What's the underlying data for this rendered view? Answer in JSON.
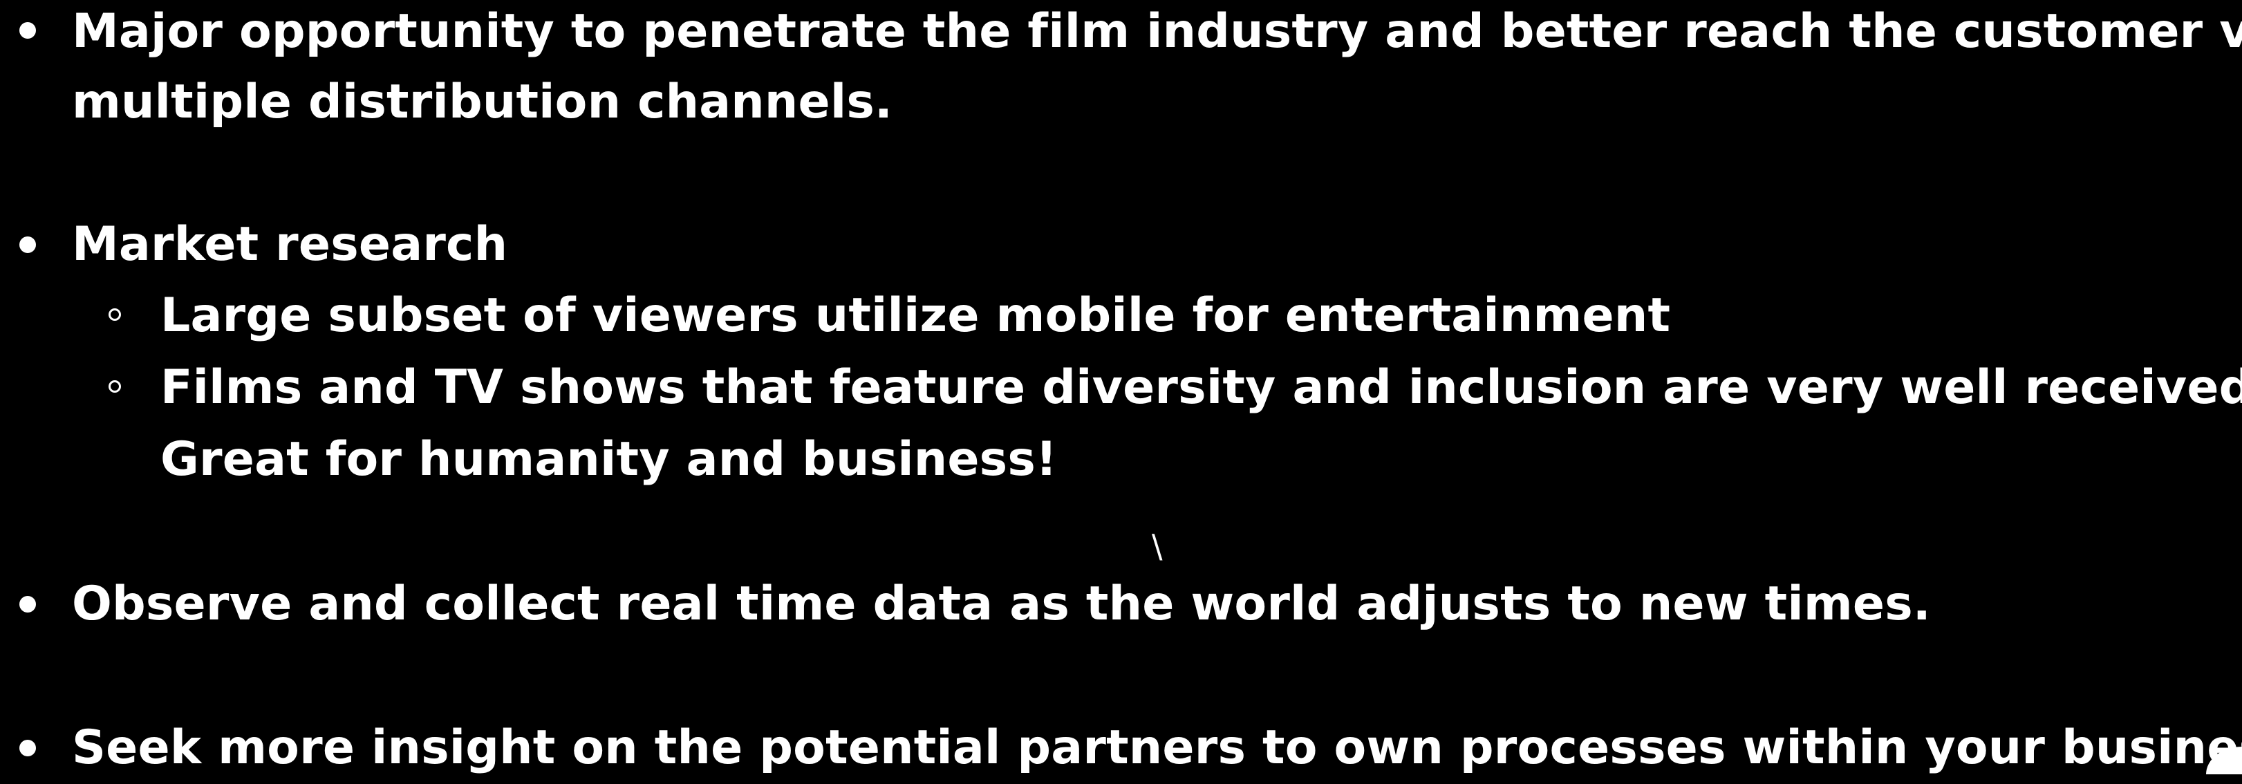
{
  "bullets": {
    "b1_line1": "Major opportunity to penetrate the film industry and better reach the customer via",
    "b1_line2": "multiple distribution channels.",
    "b2": "Market research",
    "b2_sub1": "Large subset of  viewers utilize mobile for entertainment",
    "b2_sub2_line1": "Films and TV shows that feature diversity and inclusion are very well received.",
    "b2_sub2_line2": "Great for humanity and business!",
    "b3": "Observe and collect real time data as the  world adjusts to new times.",
    "b4": "Seek more insight on the potential partners to own processes within your business."
  },
  "stray_mark": "\\",
  "colors": {
    "background": "#000000",
    "text": "#ffffff"
  }
}
